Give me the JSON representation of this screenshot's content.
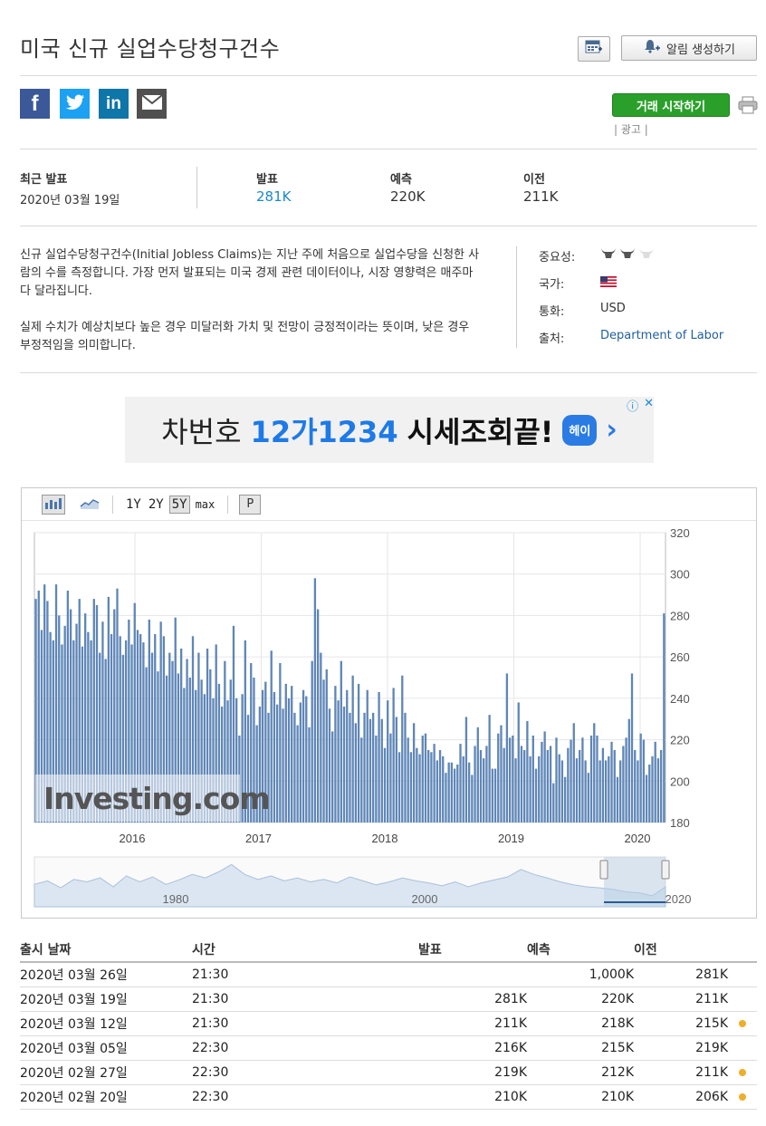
{
  "header": {
    "title": "미국 신규 실업수당청구건수",
    "alert_button": "알림 생성하기"
  },
  "social": {
    "fb": "f",
    "tw": "t",
    "li": "in"
  },
  "trade": {
    "button": "거래 시작하기",
    "ad_label": "| 광고 |"
  },
  "summary": {
    "latest_label": "최근 발표",
    "latest_date": "2020년 03월 19일",
    "actual_label": "발표",
    "actual": "281K",
    "forecast_label": "예측",
    "forecast": "220K",
    "previous_label": "이전",
    "previous": "211K"
  },
  "description": {
    "p1": "신규 실업수당청구건수(Initial Jobless Claims)는 지난 주에 처음으로 실업수당을 신청한 사람의 수를 측정합니다. 가장 먼저 발표되는 미국 경제 관련 데이터이나, 시장 영향력은 매주마다 달라집니다.",
    "p2": "실제 수치가 예상치보다 높은 경우 미달러화 가치 및 전망이 긍정적이라는 뜻이며, 낮은 경우 부정적임을 의미합니다."
  },
  "meta": {
    "importance_label": "중요성:",
    "importance_level": 2,
    "country_label": "국가:",
    "currency_label": "통화:",
    "currency": "USD",
    "source_label": "출처:",
    "source": "Department of Labor"
  },
  "ad": {
    "text1": "차번호",
    "text2": "12가1234",
    "text3": "시세조회끝!",
    "badge": "헤이",
    "arrow": "›",
    "info": "ⓘ",
    "close": "✕"
  },
  "chart_toolbar": {
    "ranges": [
      "1Y",
      "2Y",
      "5Y",
      "max"
    ],
    "active_range": "5Y",
    "p_label": "P"
  },
  "chart_data": {
    "type": "bar",
    "x_ticks": [
      "2016",
      "2017",
      "2018",
      "2019",
      "2020"
    ],
    "y_ticks": [
      "320",
      "300",
      "280",
      "260",
      "240",
      "220",
      "200",
      "180"
    ],
    "ylim": [
      180,
      320
    ],
    "watermark": "Investing.com",
    "navigator_ticks": [
      "1980",
      "2000",
      "2020"
    ],
    "values": [
      288,
      292,
      273,
      295,
      287,
      272,
      268,
      295,
      280,
      266,
      275,
      292,
      283,
      268,
      276,
      288,
      265,
      281,
      272,
      268,
      288,
      285,
      262,
      277,
      259,
      289,
      271,
      283,
      293,
      270,
      261,
      268,
      278,
      266,
      286,
      273,
      271,
      267,
      255,
      278,
      262,
      271,
      253,
      277,
      270,
      251,
      262,
      258,
      279,
      252,
      264,
      245,
      259,
      250,
      270,
      244,
      262,
      249,
      242,
      264,
      254,
      240,
      266,
      247,
      236,
      258,
      239,
      249,
      275,
      240,
      222,
      242,
      268,
      232,
      257,
      250,
      227,
      236,
      244,
      248,
      233,
      263,
      243,
      237,
      257,
      235,
      247,
      240,
      246,
      233,
      227,
      238,
      244,
      241,
      226,
      258,
      298,
      283,
      262,
      249,
      254,
      235,
      224,
      246,
      239,
      258,
      236,
      244,
      233,
      251,
      228,
      247,
      221,
      233,
      244,
      230,
      233,
      222,
      243,
      230,
      216,
      239,
      223,
      245,
      231,
      214,
      251,
      233,
      221,
      214,
      228,
      216,
      213,
      222,
      223,
      215,
      214,
      218,
      210,
      215,
      212,
      204,
      209,
      209,
      206,
      208,
      218,
      212,
      231,
      209,
      203,
      217,
      226,
      215,
      211,
      217,
      232,
      206,
      206,
      223,
      227,
      216,
      252,
      221,
      222,
      211,
      238,
      217,
      215,
      229,
      212,
      222,
      206,
      212,
      219,
      224,
      215,
      217,
      199,
      221,
      213,
      210,
      202,
      216,
      220,
      228,
      211,
      215,
      221,
      210,
      204,
      222,
      228,
      222,
      210,
      216,
      210,
      212,
      219,
      215,
      202,
      210,
      217,
      221,
      230,
      252,
      215,
      210,
      223,
      220,
      203,
      208,
      212,
      219,
      211,
      215,
      281
    ],
    "navigator": [
      [
        0,
        0.55
      ],
      [
        3,
        0.48
      ],
      [
        6,
        0.62
      ],
      [
        9,
        0.45
      ],
      [
        12,
        0.5
      ],
      [
        15,
        0.42
      ],
      [
        18,
        0.6
      ],
      [
        21,
        0.38
      ],
      [
        24,
        0.5
      ],
      [
        27,
        0.4
      ],
      [
        30,
        0.55
      ],
      [
        33,
        0.46
      ],
      [
        36,
        0.35
      ],
      [
        39,
        0.42
      ],
      [
        42,
        0.3
      ],
      [
        45,
        0.15
      ],
      [
        48,
        0.35
      ],
      [
        51,
        0.45
      ],
      [
        54,
        0.38
      ],
      [
        57,
        0.48
      ],
      [
        60,
        0.42
      ],
      [
        63,
        0.5
      ],
      [
        66,
        0.45
      ],
      [
        69,
        0.52
      ],
      [
        72,
        0.4
      ],
      [
        75,
        0.48
      ],
      [
        78,
        0.56
      ],
      [
        81,
        0.5
      ],
      [
        84,
        0.42
      ],
      [
        87,
        0.48
      ],
      [
        90,
        0.52
      ],
      [
        93,
        0.58
      ],
      [
        96,
        0.5
      ],
      [
        99,
        0.6
      ],
      [
        102,
        0.52
      ],
      [
        105,
        0.46
      ],
      [
        108,
        0.4
      ],
      [
        111,
        0.25
      ],
      [
        114,
        0.35
      ],
      [
        117,
        0.42
      ],
      [
        120,
        0.5
      ],
      [
        123,
        0.56
      ],
      [
        126,
        0.6
      ],
      [
        129,
        0.62
      ],
      [
        132,
        0.65
      ],
      [
        135,
        0.7
      ],
      [
        138,
        0.72
      ],
      [
        141,
        0.78
      ],
      [
        144,
        0.6
      ]
    ]
  },
  "table": {
    "headers": {
      "date": "출시 날짜",
      "time": "시간",
      "actual": "발표",
      "forecast": "예측",
      "previous": "이전"
    },
    "rows": [
      {
        "date": "2020년 03월 26일",
        "time": "21:30",
        "actual": "",
        "actual_class": "",
        "forecast": "1,000K",
        "previous": "281K",
        "previous_class": "",
        "dot": false
      },
      {
        "date": "2020년 03월 19일",
        "time": "21:30",
        "actual": "281K",
        "actual_class": "up",
        "forecast": "220K",
        "previous": "211K",
        "previous_class": "",
        "dot": false
      },
      {
        "date": "2020년 03월 12일",
        "time": "21:30",
        "actual": "211K",
        "actual_class": "down",
        "forecast": "218K",
        "previous": "215K",
        "previous_class": "down",
        "dot": true
      },
      {
        "date": "2020년 03월 05일",
        "time": "22:30",
        "actual": "216K",
        "actual_class": "up",
        "forecast": "215K",
        "previous": "219K",
        "previous_class": "",
        "dot": false
      },
      {
        "date": "2020년 02월 27일",
        "time": "22:30",
        "actual": "219K",
        "actual_class": "up",
        "forecast": "212K",
        "previous": "211K",
        "previous_class": "up",
        "dot": true
      },
      {
        "date": "2020년 02월 20일",
        "time": "22:30",
        "actual": "210K",
        "actual_class": "",
        "forecast": "210K",
        "previous": "206K",
        "previous_class": "up",
        "dot": true
      }
    ]
  },
  "colors": {
    "bar": "#5f86b7",
    "link": "#1f5f9e",
    "up": "#1e88c9",
    "down": "#d91e18",
    "trade_button": "#2aa02a",
    "dot": "#f0ad2a"
  }
}
